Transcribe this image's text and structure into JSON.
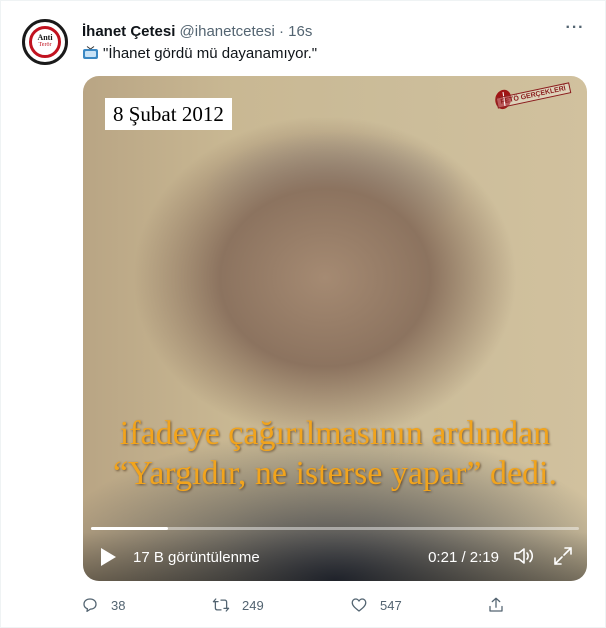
{
  "tweet": {
    "author_name": "İhanet Çetesi",
    "handle": "@ihanetcetesi",
    "separator": "·",
    "time": "16s",
    "text": "\"İhanet gördü mü dayanamıyor.\"",
    "more_icon": "ellipsis-icon",
    "avatar": {
      "line1": "Anti",
      "line2": "Terör"
    }
  },
  "video": {
    "date_overlay": "8 Şubat 2012",
    "watermark": "FETÖ GERÇEKLERİ",
    "caption_line1": "ifadeye çağırılmasının ardından",
    "caption_line2": "“Yargıdır, ne isterse yapar” dedi.",
    "views": "17 B görüntülenme",
    "duration": "0:21 / 2:19",
    "progress_fraction": 0.157,
    "caption_color": "#f2a41c"
  },
  "actions": {
    "replies": "38",
    "retweets": "249",
    "likes": "547"
  }
}
